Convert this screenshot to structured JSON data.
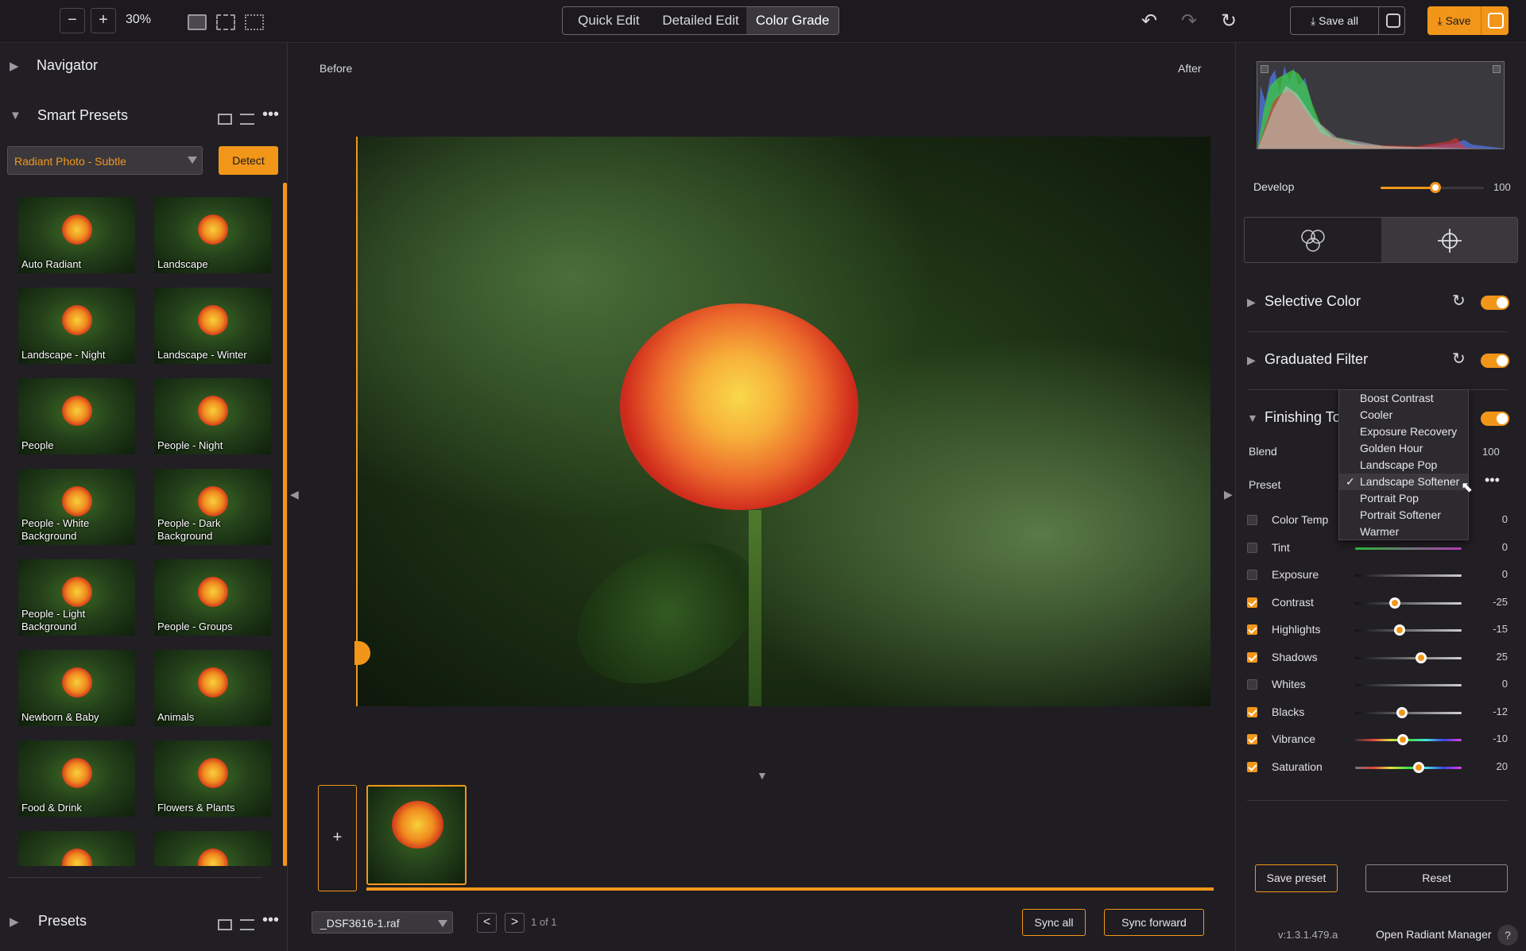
{
  "toolbar": {
    "zoom_out": "−",
    "zoom_in": "+",
    "zoom_level": "30%",
    "modes": [
      {
        "label": "Quick Edit",
        "active": false
      },
      {
        "label": "Detailed Edit",
        "active": false
      },
      {
        "label": "Color Grade",
        "active": true
      }
    ],
    "save_all_label": "Save all",
    "save_label": "Save"
  },
  "left_panel": {
    "navigator_title": "Navigator",
    "smart_presets_title": "Smart Presets",
    "preset_select_value": "Radiant Photo - Subtle",
    "detect_label": "Detect",
    "presets_title": "Presets",
    "thumbnails": [
      "Auto Radiant",
      "Landscape",
      "Landscape - Night",
      "Landscape - Winter",
      "People",
      "People - Night",
      "People - White\nBackground",
      "People - Dark\nBackground",
      "People - Light\nBackground",
      "People - Groups",
      "Newborn & Baby",
      "Animals",
      "Food & Drink",
      "Flowers & Plants",
      "",
      ""
    ]
  },
  "center": {
    "before_label": "Before",
    "after_label": "After",
    "film_add": "+",
    "file_name": "_DSF3616-1.raf",
    "prev": "<",
    "next": ">",
    "page_count": "1 of 1",
    "sync_all_label": "Sync all",
    "sync_forward_label": "Sync forward"
  },
  "right_panel": {
    "develop_label": "Develop",
    "develop_value": "100",
    "develop_level": 0.53,
    "sections": [
      {
        "title": "Selective Color",
        "enabled": true
      },
      {
        "title": "Graduated Filter",
        "enabled": true
      },
      {
        "title": "Finishing Tools",
        "enabled": true
      }
    ],
    "blend_label": "Blend",
    "blend_value": "100",
    "preset_label": "Preset",
    "preset_menu": [
      {
        "label": "Boost Contrast",
        "selected": false
      },
      {
        "label": "Cooler",
        "selected": false
      },
      {
        "label": "Exposure Recovery",
        "selected": false
      },
      {
        "label": "Golden Hour",
        "selected": false
      },
      {
        "label": "Landscape Pop",
        "selected": false
      },
      {
        "label": "Landscape Softener",
        "selected": true
      },
      {
        "label": "Portrait Pop",
        "selected": false
      },
      {
        "label": "Portrait Softener",
        "selected": false
      },
      {
        "label": "Warmer",
        "selected": false
      }
    ],
    "adjustments": [
      {
        "label": "Color Temp",
        "value": "0",
        "checked": false,
        "level": null
      },
      {
        "label": "Tint",
        "value": "0",
        "checked": false,
        "level": null
      },
      {
        "label": "Exposure",
        "value": "0",
        "checked": false,
        "level": null
      },
      {
        "label": "Contrast",
        "value": "-25",
        "checked": true,
        "level": 0.37
      },
      {
        "label": "Highlights",
        "value": "-15",
        "checked": true,
        "level": 0.42
      },
      {
        "label": "Shadows",
        "value": "25",
        "checked": true,
        "level": 0.62
      },
      {
        "label": "Whites",
        "value": "0",
        "checked": false,
        "level": null
      },
      {
        "label": "Blacks",
        "value": "-12",
        "checked": true,
        "level": 0.44
      },
      {
        "label": "Vibrance",
        "value": "-10",
        "checked": true,
        "level": 0.45
      },
      {
        "label": "Saturation",
        "value": "20",
        "checked": true,
        "level": 0.6
      }
    ],
    "save_preset_label": "Save preset",
    "reset_label": "Reset",
    "version": "v:1.3.1.479.a",
    "open_manager_label": "Open Radiant Manager",
    "help": "?"
  },
  "colors": {
    "accent": "#f2961a",
    "bg": "#1c1a1e",
    "panel": "#211f24"
  }
}
